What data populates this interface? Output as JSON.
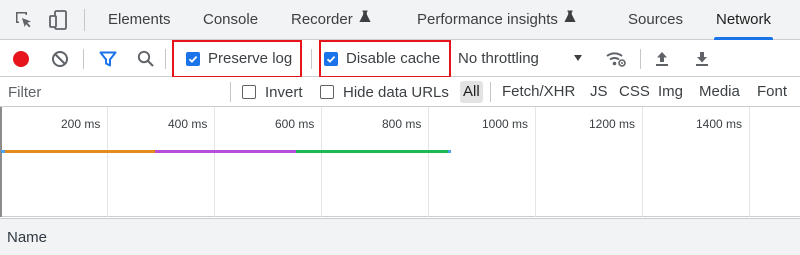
{
  "tabs": [
    {
      "label": "Elements",
      "active": false
    },
    {
      "label": "Console",
      "active": false
    },
    {
      "label": "Recorder",
      "active": false,
      "experimental": true
    },
    {
      "label": "Performance insights",
      "active": false,
      "experimental": true
    },
    {
      "label": "Sources",
      "active": false
    },
    {
      "label": "Network",
      "active": true
    }
  ],
  "toolbar": {
    "preserve_log": {
      "label": "Preserve log",
      "checked": true
    },
    "disable_cache": {
      "label": "Disable cache",
      "checked": true
    },
    "throttling": "No throttling",
    "icons": [
      "record-icon",
      "clear-icon",
      "filter-icon",
      "search-icon",
      "network-conditions-icon",
      "import-icon",
      "export-icon"
    ]
  },
  "filter": {
    "placeholder": "Filter",
    "invert": {
      "label": "Invert",
      "checked": false
    },
    "hide_data_urls": {
      "label": "Hide data URLs",
      "checked": false
    },
    "types": [
      "All",
      "Fetch/XHR",
      "JS",
      "CSS",
      "Img",
      "Media",
      "Font"
    ],
    "active_type": "All"
  },
  "timeline": {
    "ticks": [
      "200 ms",
      "400 ms",
      "600 ms",
      "800 ms",
      "1000 ms",
      "1200 ms",
      "1400 ms"
    ],
    "colors": {
      "gridline": "#e4e4e4",
      "orange": "#e18d1c",
      "purple": "#b64fd8",
      "green": "#1db954",
      "blue": "#4aa3e8"
    }
  },
  "requests": {
    "columns": [
      "Name"
    ]
  },
  "colors": {
    "accent": "#1a73e8",
    "record": "#e8141b",
    "highlight": "#e8141b"
  }
}
